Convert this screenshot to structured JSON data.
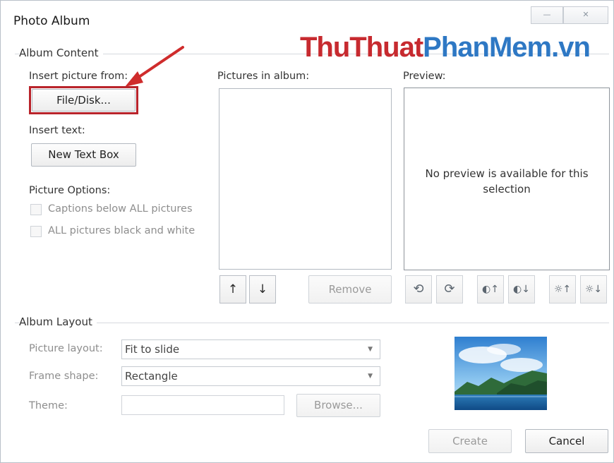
{
  "window": {
    "title": "Photo Album",
    "minimize_glyph": "—",
    "close_glyph": "✕"
  },
  "watermark": {
    "part1": "ThuThuat",
    "part2": "PhanMem.vn"
  },
  "album_content": {
    "heading": "Album Content",
    "insert_from_label": "Insert picture from:",
    "file_disk_button": "File/Disk...",
    "insert_text_label": "Insert text:",
    "new_text_box_button": "New Text Box",
    "picture_options_label": "Picture Options:",
    "captions_option": "Captions below ALL pictures",
    "bw_option": "ALL pictures black and white",
    "pictures_in_album_label": "Pictures in album:",
    "preview_label": "Preview:",
    "preview_message": "No preview is available for this selection",
    "move_up_glyph": "↑",
    "move_down_glyph": "↓",
    "remove_button": "Remove",
    "image_tools": [
      {
        "name": "rotate-left-icon",
        "glyph": "⟲"
      },
      {
        "name": "rotate-right-icon",
        "glyph": "⟳"
      },
      {
        "name": "contrast-up-icon",
        "glyph": "◐↑"
      },
      {
        "name": "contrast-down-icon",
        "glyph": "◐↓"
      },
      {
        "name": "brightness-up-icon",
        "glyph": "☼↑"
      },
      {
        "name": "brightness-down-icon",
        "glyph": "☼↓"
      }
    ]
  },
  "album_layout": {
    "heading": "Album Layout",
    "picture_layout_label": "Picture layout:",
    "picture_layout_value": "Fit to slide",
    "frame_shape_label": "Frame shape:",
    "frame_shape_value": "Rectangle",
    "theme_label": "Theme:",
    "theme_value": "",
    "browse_button": "Browse..."
  },
  "footer": {
    "create_button": "Create",
    "cancel_button": "Cancel"
  },
  "colors": {
    "highlight": "#b9242b",
    "watermark_red": "#c72a2f",
    "watermark_blue": "#2e78c4"
  }
}
